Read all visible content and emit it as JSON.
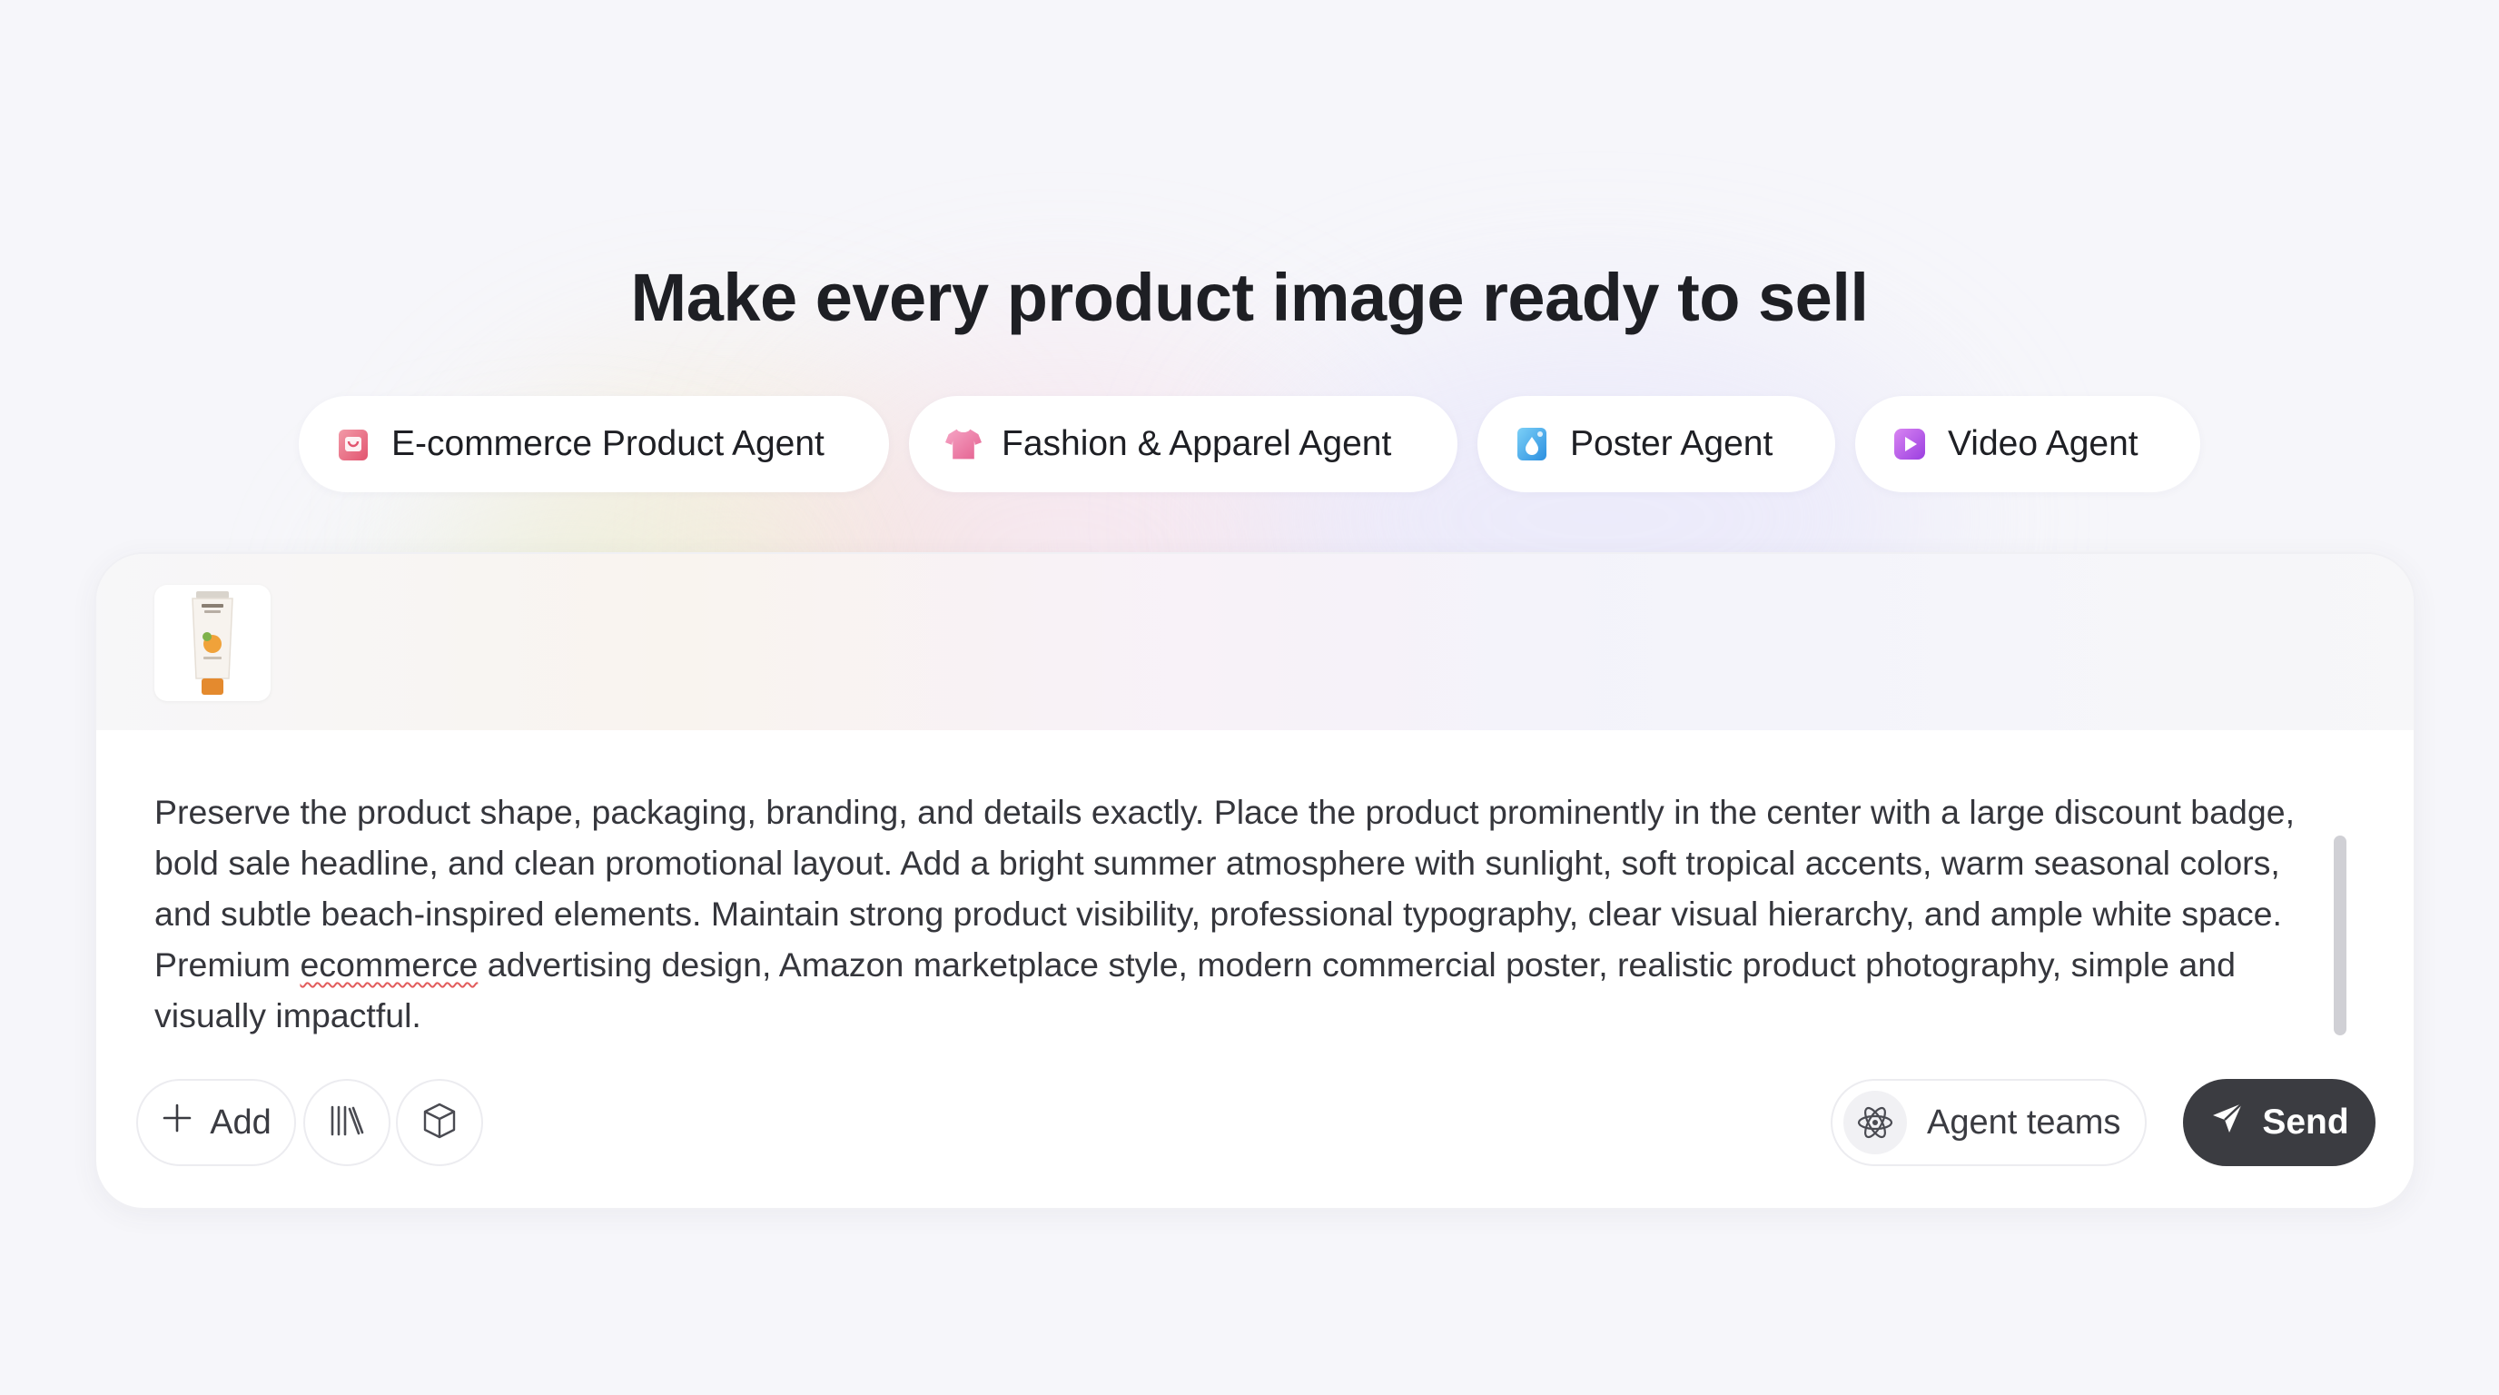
{
  "headline": "Make every product image ready to sell",
  "agents": [
    {
      "label": "E-commerce Product Agent",
      "icon": "shopping-bag-icon",
      "color": "#e8607c"
    },
    {
      "label": "Fashion & Apparel Agent",
      "icon": "tshirt-icon",
      "color": "#e97aa3"
    },
    {
      "label": "Poster Agent",
      "icon": "poster-icon",
      "color": "#3fa4e6"
    },
    {
      "label": "Video Agent",
      "icon": "video-play-icon",
      "color": "#b34fe0"
    }
  ],
  "composer": {
    "attachment": {
      "type": "product-image",
      "icon": "product-tube-thumbnail"
    },
    "prompt_before": "Preserve the product shape, packaging, branding, and details exactly. Place the product prominently in the center with a large discount badge, bold sale headline, and clean promotional layout. Add a bright summer atmosphere with sunlight, soft tropical accents, warm seasonal colors, and subtle beach-inspired elements. Maintain strong product visibility, professional typography, clear visual hierarchy, and ample white space. Premium ",
    "prompt_misspelled": "ecommerce",
    "prompt_after": " advertising design, Amazon marketplace style, modern commercial poster, realistic product photography, simple and visually impactful.",
    "add_label": "Add",
    "library_icon": "library-icon",
    "model_icon": "cube-icon",
    "agent_teams_label": "Agent teams",
    "agent_teams_icon": "atom-icon",
    "send_label": "Send",
    "send_icon": "send-icon",
    "send_color": "#3b3c41"
  }
}
